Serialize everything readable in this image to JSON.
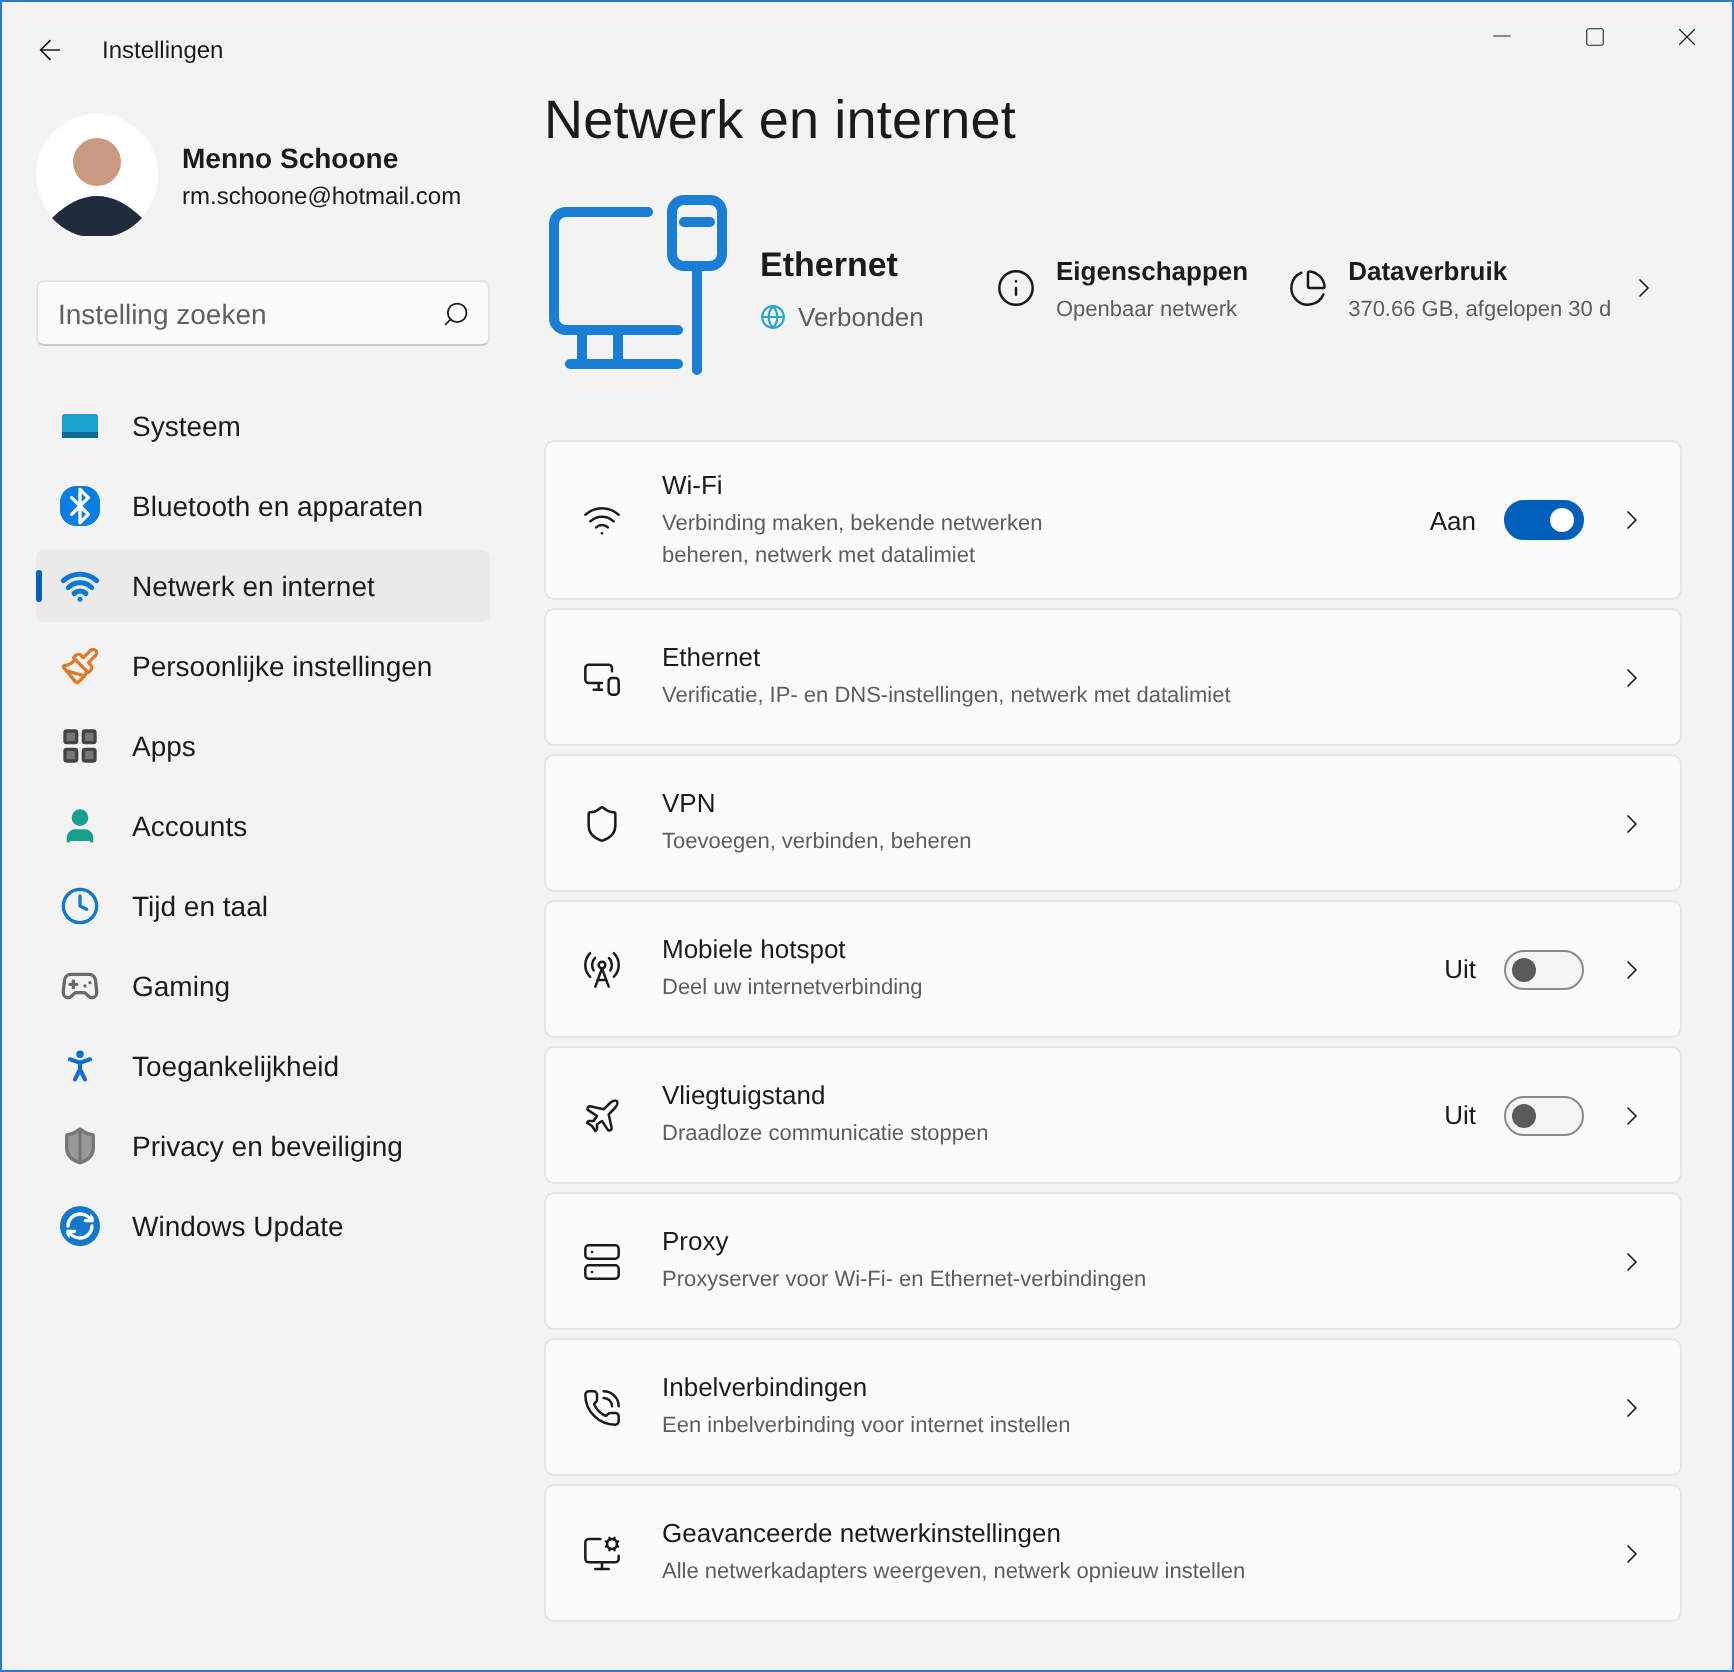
{
  "window": {
    "title": "Instellingen"
  },
  "account": {
    "name": "Menno Schoone",
    "email": "rm.schoone@hotmail.com"
  },
  "search": {
    "placeholder": "Instelling zoeken"
  },
  "sidebar": {
    "items": [
      {
        "label": "Systeem",
        "selected": false
      },
      {
        "label": "Bluetooth en apparaten",
        "selected": false
      },
      {
        "label": "Netwerk en internet",
        "selected": true
      },
      {
        "label": "Persoonlijke instellingen",
        "selected": false
      },
      {
        "label": "Apps",
        "selected": false
      },
      {
        "label": "Accounts",
        "selected": false
      },
      {
        "label": "Tijd en taal",
        "selected": false
      },
      {
        "label": "Gaming",
        "selected": false
      },
      {
        "label": "Toegankelijkheid",
        "selected": false
      },
      {
        "label": "Privacy en beveiliging",
        "selected": false
      },
      {
        "label": "Windows Update",
        "selected": false
      }
    ]
  },
  "page": {
    "title": "Netwerk en internet"
  },
  "connection": {
    "name": "Ethernet",
    "status": "Verbonden",
    "properties": {
      "title": "Eigenschappen",
      "detail": "Openbaar netwerk"
    },
    "data_usage": {
      "title": "Dataverbruik",
      "detail": "370.66 GB, afgelopen 30 d"
    }
  },
  "settings": [
    {
      "kind": "toggle",
      "title": "Wi-Fi",
      "description": "Verbinding maken, bekende netwerken beheren, netwerk met datalimiet",
      "state_label": "Aan",
      "on": true
    },
    {
      "kind": "link",
      "title": "Ethernet",
      "description": "Verificatie, IP- en DNS-instellingen, netwerk met datalimiet"
    },
    {
      "kind": "link",
      "title": "VPN",
      "description": "Toevoegen, verbinden, beheren"
    },
    {
      "kind": "toggle",
      "title": "Mobiele hotspot",
      "description": "Deel uw internetverbinding",
      "state_label": "Uit",
      "on": false
    },
    {
      "kind": "toggle",
      "title": "Vliegtuigstand",
      "description": "Draadloze communicatie stoppen",
      "state_label": "Uit",
      "on": false
    },
    {
      "kind": "link",
      "title": "Proxy",
      "description": "Proxyserver voor Wi-Fi- en Ethernet-verbindingen"
    },
    {
      "kind": "link",
      "title": "Inbelverbindingen",
      "description": "Een inbelverbinding voor internet instellen"
    },
    {
      "kind": "link",
      "title": "Geavanceerde netwerkinstellingen",
      "description": "Alle netwerkadapters weergeven, netwerk opnieuw instellen"
    }
  ]
}
